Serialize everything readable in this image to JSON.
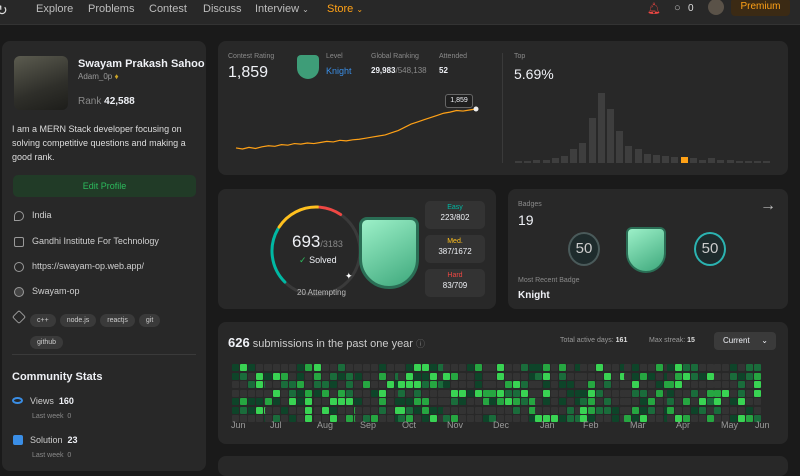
{
  "nav": {
    "items": [
      "Explore",
      "Problems",
      "Contest",
      "Discuss",
      "Interview",
      "Store"
    ],
    "coins": "0",
    "premium": "Premium"
  },
  "profile": {
    "name": "Swayam Prakash Sahoo",
    "username": "Adam_0p",
    "rank_label": "Rank",
    "rank": "42,588",
    "bio": "I am a MERN Stack developer focusing on solving competitive questions and making a good rank.",
    "edit": "Edit Profile",
    "location": "India",
    "school": "Gandhi Institute For Technology",
    "website": "https://swayam-op.web.app/",
    "github": "Swayam-op",
    "tags": [
      "c++",
      "node.js",
      "reactjs",
      "git",
      "github"
    ]
  },
  "community": {
    "title": "Community Stats",
    "views_label": "Views",
    "views": "160",
    "views_sub": "Last week",
    "views_delta": "0",
    "solution_label": "Solution",
    "solution": "23",
    "solution_sub": "Last week",
    "solution_delta": "0"
  },
  "contest": {
    "rating_label": "Contest Rating",
    "rating": "1,859",
    "level_label": "Level",
    "level": "Knight",
    "global_label": "Global Ranking",
    "global": "29,983",
    "global_total": "/548,138",
    "attended_label": "Attended",
    "attended": "52",
    "top_label": "Top",
    "top": "5.69%",
    "tooltip": "1,859",
    "rating_history": [
      1500,
      1490,
      1505,
      1495,
      1510,
      1520,
      1515,
      1530,
      1525,
      1540,
      1535,
      1545,
      1540,
      1550,
      1560,
      1555,
      1570,
      1565,
      1575,
      1580,
      1590,
      1600,
      1610,
      1620,
      1640,
      1660,
      1690,
      1720,
      1740,
      1760,
      1780,
      1800,
      1820,
      1830,
      1845,
      1840,
      1850,
      1859
    ],
    "distribution": [
      2,
      2,
      3,
      3,
      4,
      6,
      12,
      18,
      40,
      62,
      48,
      28,
      15,
      12,
      8,
      7,
      6,
      5,
      5,
      4,
      3,
      4,
      3,
      3,
      2,
      2,
      2,
      2
    ]
  },
  "solved": {
    "solved": "693",
    "total": "/3183",
    "solved_label": "Solved",
    "attempting": "20 Attempting",
    "easy_label": "Easy",
    "easy": "223/802",
    "med_label": "Med.",
    "med": "387/1672",
    "hard_label": "Hard",
    "hard": "83/709",
    "easy_frac": 0.278,
    "med_frac": 0.231,
    "hard_frac": 0.117
  },
  "badges": {
    "label": "Badges",
    "count": "19",
    "recent_label": "Most Recent Badge",
    "recent": "Knight",
    "items": [
      "50",
      "Knight",
      "50"
    ]
  },
  "submissions": {
    "count": "626",
    "title": "submissions in the past one year",
    "active_label": "Total active days:",
    "active": "161",
    "streak_label": "Max streak:",
    "streak": "15",
    "select": "Current",
    "months": [
      "Jun",
      "Jul",
      "Aug",
      "Sep",
      "Oct",
      "Nov",
      "Dec",
      "Jan",
      "Feb",
      "Mar",
      "Apr",
      "May",
      "Jun"
    ]
  },
  "colors": {
    "accent": "#ffa116",
    "easy": "#00b8a3",
    "med": "#ffc01e",
    "hard": "#ef4743",
    "knight": "#5fd0a0"
  }
}
